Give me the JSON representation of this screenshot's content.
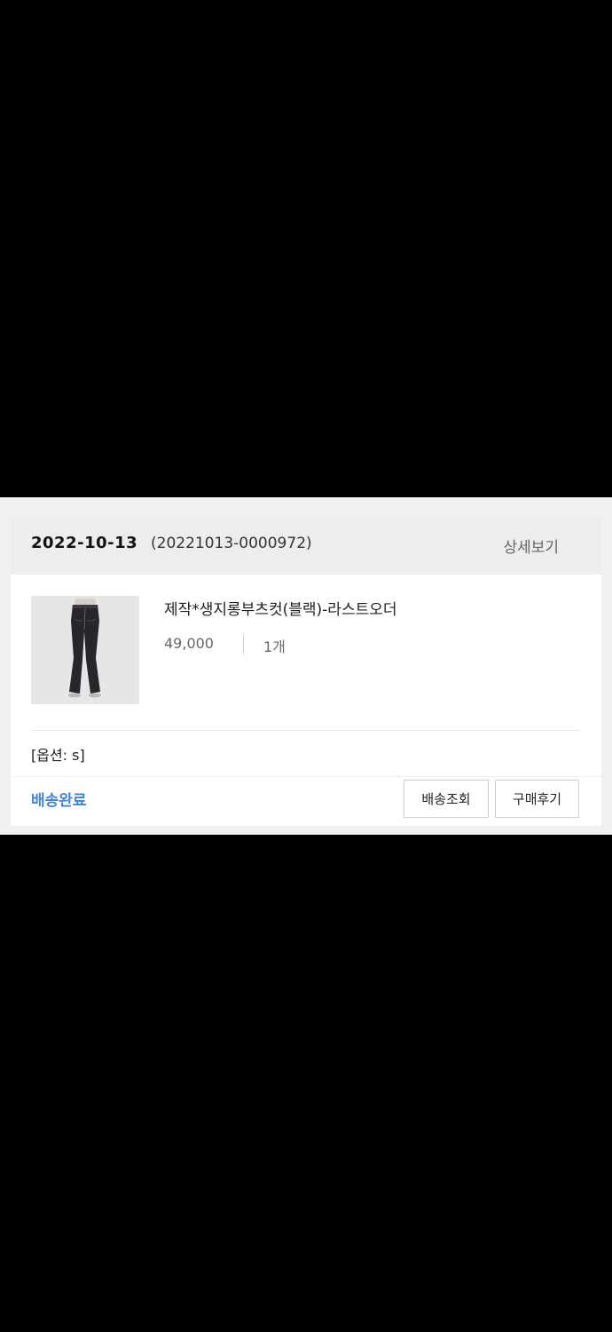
{
  "order": {
    "date": "2022-10-13",
    "number": "(20221013-0000972)",
    "detail_label": "상세보기"
  },
  "product": {
    "name": "제작*생지롱부츠컷(블랙)-라스트오더",
    "price": "49,000",
    "quantity": "1개",
    "option": "[옵션: s]",
    "image_icon": "jeans-product-photo"
  },
  "footer": {
    "status": "배송완료",
    "track_label": "배송조회",
    "review_label": "구매후기"
  },
  "colors": {
    "status": "#3f86d9",
    "header_bg": "#ededed",
    "page_bg": "#000000"
  }
}
